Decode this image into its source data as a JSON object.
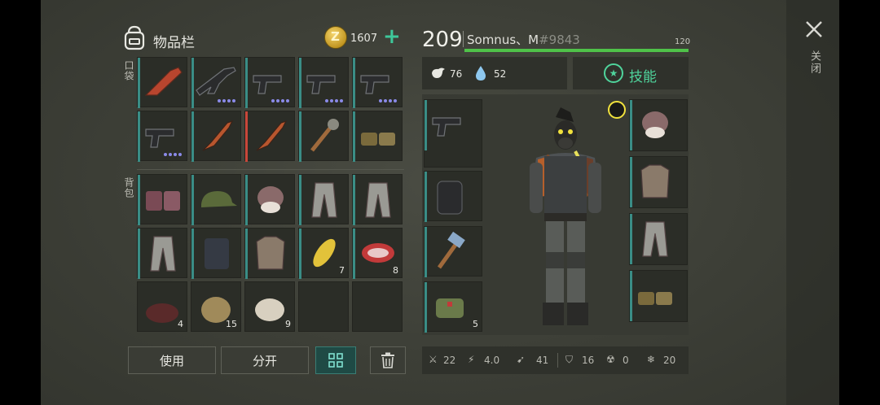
{
  "inventory": {
    "title": "物品栏",
    "coins": "1607",
    "coin_letter": "Z",
    "add_label": "+",
    "pocket_label": "口袋",
    "backpack_label": "背包",
    "pocket_items": [
      {
        "name": "flare-gun",
        "count": "",
        "dots": 0
      },
      {
        "name": "assault-rifle",
        "count": "",
        "dots": 4
      },
      {
        "name": "pistol",
        "count": "",
        "dots": 4
      },
      {
        "name": "pistol",
        "count": "",
        "dots": 4
      },
      {
        "name": "pistol",
        "count": "",
        "dots": 4
      },
      {
        "name": "pistol",
        "count": "",
        "dots": 4
      },
      {
        "name": "knife",
        "count": "",
        "dots": 0
      },
      {
        "name": "knife",
        "count": "",
        "dots": 0
      },
      {
        "name": "spiked-club",
        "count": "",
        "dots": 0
      },
      {
        "name": "boots",
        "count": "",
        "dots": 0
      }
    ],
    "backpack_items": [
      {
        "name": "spiked-boots",
        "count": ""
      },
      {
        "name": "camo-cap",
        "count": ""
      },
      {
        "name": "fur-hat",
        "count": ""
      },
      {
        "name": "pants",
        "count": ""
      },
      {
        "name": "pants",
        "count": ""
      },
      {
        "name": "pants",
        "count": ""
      },
      {
        "name": "tactical-vest",
        "count": ""
      },
      {
        "name": "armor-jacket",
        "count": ""
      },
      {
        "name": "corn",
        "count": "7"
      },
      {
        "name": "raw-meat",
        "count": "8"
      },
      {
        "name": "berries",
        "count": "4"
      },
      {
        "name": "hay",
        "count": "15"
      },
      {
        "name": "fiber",
        "count": "9"
      },
      {
        "name": "empty",
        "count": ""
      },
      {
        "name": "empty",
        "count": ""
      }
    ],
    "buttons": {
      "use": "使用",
      "split": "分开"
    }
  },
  "character": {
    "level": "209",
    "name": "Somnus、M",
    "tag": "#9843",
    "xp_max": "120",
    "xp_fraction": 1.0,
    "hunger": "76",
    "thirst": "52",
    "skills_label": "技能",
    "left_equipment": [
      {
        "name": "pistol",
        "count": ""
      },
      {
        "name": "backpack",
        "count": ""
      },
      {
        "name": "hammer",
        "count": ""
      },
      {
        "name": "medkit-bag",
        "count": "5"
      }
    ],
    "right_equipment": [
      {
        "name": "fur-hat"
      },
      {
        "name": "armor-jacket"
      },
      {
        "name": "pants"
      },
      {
        "name": "boots"
      }
    ],
    "stats": {
      "melee": "22",
      "attack_speed": "4.0",
      "move_speed": "41",
      "defense": "16",
      "radiation": "0",
      "cold": "20"
    }
  },
  "close_label": "关闭",
  "colors": {
    "accent_green": "#4fd49c",
    "xp_green": "#4fc249",
    "teal_bar": "#3a8d86",
    "red_bar": "#c9473a",
    "coin_gold": "#e0b33a"
  }
}
